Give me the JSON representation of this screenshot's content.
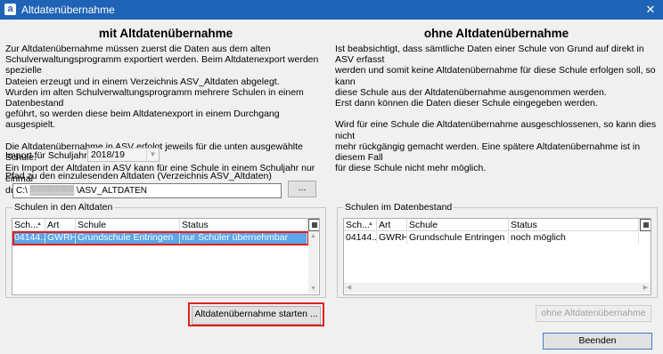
{
  "window": {
    "title": "Altdatenübernahme",
    "app_icon": "a",
    "close_glyph": "✕"
  },
  "left": {
    "heading": "mit Altdatenübernahme",
    "description": "Zur Altdatenübernahme müssen zuerst die Daten aus dem alten\nSchulverwaltungsprogramm exportiert werden. Beim Altdatenexport werden spezielle\nDateien erzeugt und in einem Verzeichnis ASV_Altdaten abgelegt.\nWurden im alten Schulverwaltungsprogramm mehrere Schulen in einem Datenbestand\ngeführt, so werden diese beim Altdatenexport in einem Durchgang ausgespielt.\n\nDie Altdatenübernahme in ASV erfolgt jeweils für die unten ausgewählte Schule.\nEin Import der Altdaten in ASV kann für eine Schule in einem Schuljahr nur einmal\ndurchgeführt werden.",
    "schuljahr_label": "Import für Schuljahr",
    "schuljahr_value": "2018/19",
    "path_label": "Pfad zu den einzulesenden Altdaten (Verzeichnis ASV_Altdaten)",
    "path_value": "C:\\ ▒▒▒▒▒▒▒ \\ASV_ALTDATEN",
    "browse_label": "...",
    "group_title": "Schulen in den Altdaten",
    "columns": [
      "Sch...",
      "Art",
      "Schule",
      "Status"
    ],
    "rows": [
      {
        "nr": "04144...",
        "art": "GWRHS",
        "schule": "Grundschule Entringen",
        "status": "nur Schüler übernehmbar"
      }
    ],
    "start_button": "Altdatenübernahme starten ..."
  },
  "right": {
    "heading": "ohne Altdatenübernahme",
    "description": "Ist beabsichtigt, dass sämtliche Daten einer Schule von Grund auf direkt in ASV erfasst\nwerden und somit keine Altdatenübernahme für diese Schule erfolgen soll, so kann\ndiese Schule aus der Altdatenübernahme ausgenommen werden.\nErst dann können die Daten dieser Schule eingegeben werden.\n\nWird für eine Schule die Altdatenübernahme ausgeschlossenen, so kann dies nicht\nmehr rückgängig gemacht werden. Eine spätere Altdatenübernahme ist in diesem Fall\nfür diese Schule nicht mehr möglich.",
    "group_title": "Schulen im Datenbestand",
    "columns": [
      "Sch...",
      "Art",
      "Schule",
      "Status"
    ],
    "rows": [
      {
        "nr": "04144...",
        "art": "GWRHS",
        "schule": "Grundschule Entringen",
        "status": "noch möglich"
      }
    ],
    "ohne_button": "ohne Altdatenübernahme",
    "close_button": "Beenden"
  },
  "icons": {
    "sort": "▲",
    "combo_arrow": "▼",
    "column_chooser": "▦",
    "scroll_up": "▲",
    "scroll_down": "▼",
    "scroll_left": "◀",
    "scroll_right": "▶"
  },
  "colors": {
    "titlebar": "#1e63b5",
    "selection": "#5ba5e8",
    "highlight": "#e02020"
  }
}
